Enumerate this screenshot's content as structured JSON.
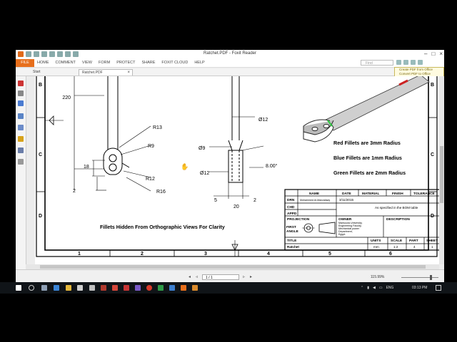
{
  "window": {
    "title": "Ratchet.PDF - Foxit Reader"
  },
  "ribbon": {
    "file_tab": "FILE",
    "tabs": [
      "HOME",
      "COMMENT",
      "VIEW",
      "FORM",
      "PROTECT",
      "SHARE",
      "FOXIT CLOUD",
      "HELP"
    ],
    "find_placeholder": "Find"
  },
  "popup": {
    "line1": "Create PDF from Office",
    "line2": "Convert PDF to Office"
  },
  "doc_tabs": [
    "Start",
    "Ratchet.PDF"
  ],
  "drawing": {
    "frame_rows": [
      "B",
      "C",
      "D"
    ],
    "frame_cols": [
      "1",
      "2",
      "3",
      "4",
      "5",
      "6"
    ],
    "dims": {
      "d220": "220",
      "r13": "R13",
      "r9": "R9",
      "d18": "18",
      "r12": "R12",
      "r16": "R16",
      "d2": "2",
      "dia12_top": "Ø12",
      "dia9": "Ø9",
      "dia12": "Ø12",
      "d5": "5",
      "d20": "20",
      "d2b": "2",
      "angle": "8.00°"
    },
    "notes": {
      "red": "Red Fillets are 3mm Radius",
      "blue": "Blue Fillets are 1mm Radius",
      "green": "Green Fillets are 2mm Radius",
      "hidden": "Fillets Hidden From Orthographic Views For Clarity"
    },
    "title_block": {
      "h_name": "NAME",
      "h_date": "DATE",
      "h_material": "MATERIAL",
      "h_finish": "FINISH",
      "h_tolerance": "TOLERANCE",
      "drn": "DRN",
      "drn_name": "Mohammed Al-Manzalawy",
      "drn_date": "3/11/2015",
      "chd": "CHD",
      "appd": "APPD",
      "bom": "As specified in the BOM table",
      "projection": "PROJECTION",
      "first": "FIRST",
      "angle": "ANGLE",
      "owner": "OWNER",
      "owner_l1": "Mansoura University,",
      "owner_l2": "Engineering Faculty,",
      "owner_l3": "Mechanical power",
      "owner_l4": "Department,",
      "owner_l5": "Egypt.",
      "description": "DESCRIPTION",
      "title": "TITLE",
      "title_val": "Ratchet",
      "units": "UNITS",
      "units_val": "mm",
      "scale": "SCALE",
      "scale_val": "1:2",
      "part": "PART",
      "part_val": "4",
      "sheet": "SHEET",
      "sheet_val": "1"
    }
  },
  "statusbar": {
    "page": "1 / 1",
    "zoom": "115.99%"
  },
  "taskbar": {
    "lang": "ENG",
    "time": "03:13 PM"
  },
  "colors": {
    "accent": "#e76f1c",
    "fillet_red": "#cc2222",
    "fillet_green": "#2ecc40"
  }
}
